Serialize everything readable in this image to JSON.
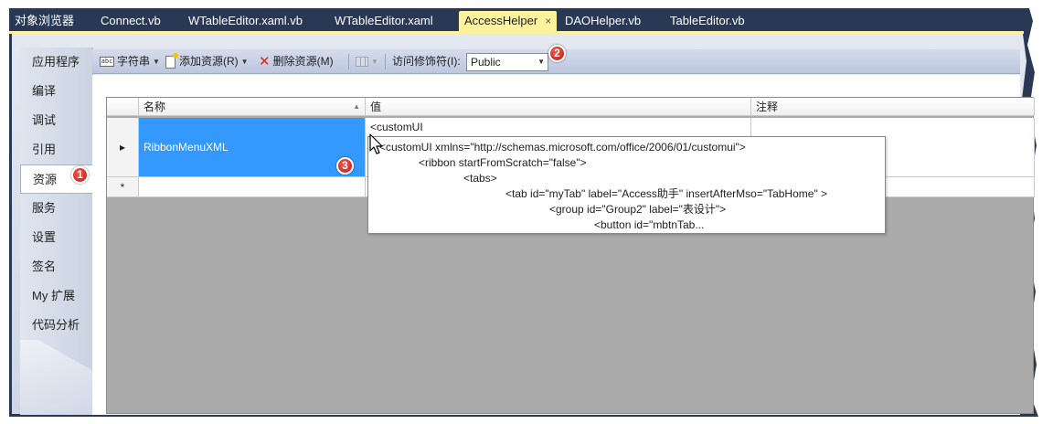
{
  "doc_tabs": [
    {
      "label": "对象浏览器"
    },
    {
      "label": "Connect.vb"
    },
    {
      "label": "WTableEditor.xaml.vb"
    },
    {
      "label": "WTableEditor.xaml"
    },
    {
      "label": "AccessHelper",
      "active": true,
      "close": "×"
    },
    {
      "label": "DAOHelper.vb"
    },
    {
      "label": "TableEditor.vb"
    }
  ],
  "sidebar": {
    "items": [
      {
        "label": "应用程序"
      },
      {
        "label": "编译"
      },
      {
        "label": "调试"
      },
      {
        "label": "引用"
      },
      {
        "label": "资源",
        "active": true
      },
      {
        "label": "服务"
      },
      {
        "label": "设置"
      },
      {
        "label": "签名"
      },
      {
        "label": "My 扩展"
      },
      {
        "label": "代码分析"
      }
    ]
  },
  "toolbar": {
    "strings_label": "字符串",
    "add_resource_label": "添加资源(R)",
    "remove_resource_label": "删除资源(M)",
    "access_modifier_label": "访问修饰符(I):",
    "access_modifier_value": "Public"
  },
  "grid": {
    "columns": [
      "名称",
      "值",
      "注释"
    ],
    "rows": [
      {
        "marker": "▸",
        "name": "RibbonMenuXML",
        "value": "<customUI",
        "comment": ""
      },
      {
        "marker": "*",
        "name": "",
        "value": "",
        "comment": ""
      }
    ]
  },
  "popup_lines": [
    "<customUI xmlns=\"http://schemas.microsoft.com/office/2006/01/customui\">",
    "<ribbon startFromScratch=\"false\">",
    "<tabs>",
    "<tab id=\"myTab\" label=\"Access助手\" insertAfterMso=\"TabHome\" >",
    "<group id=\"Group2\" label=\"表设计\">",
    "<button id=\"mbtnTab..."
  ],
  "badges": [
    "1",
    "2",
    "3"
  ],
  "colors": {
    "frame": "#293955",
    "active_tab": "#fff29d",
    "selection": "#3399ff",
    "badge": "#c21a10"
  }
}
